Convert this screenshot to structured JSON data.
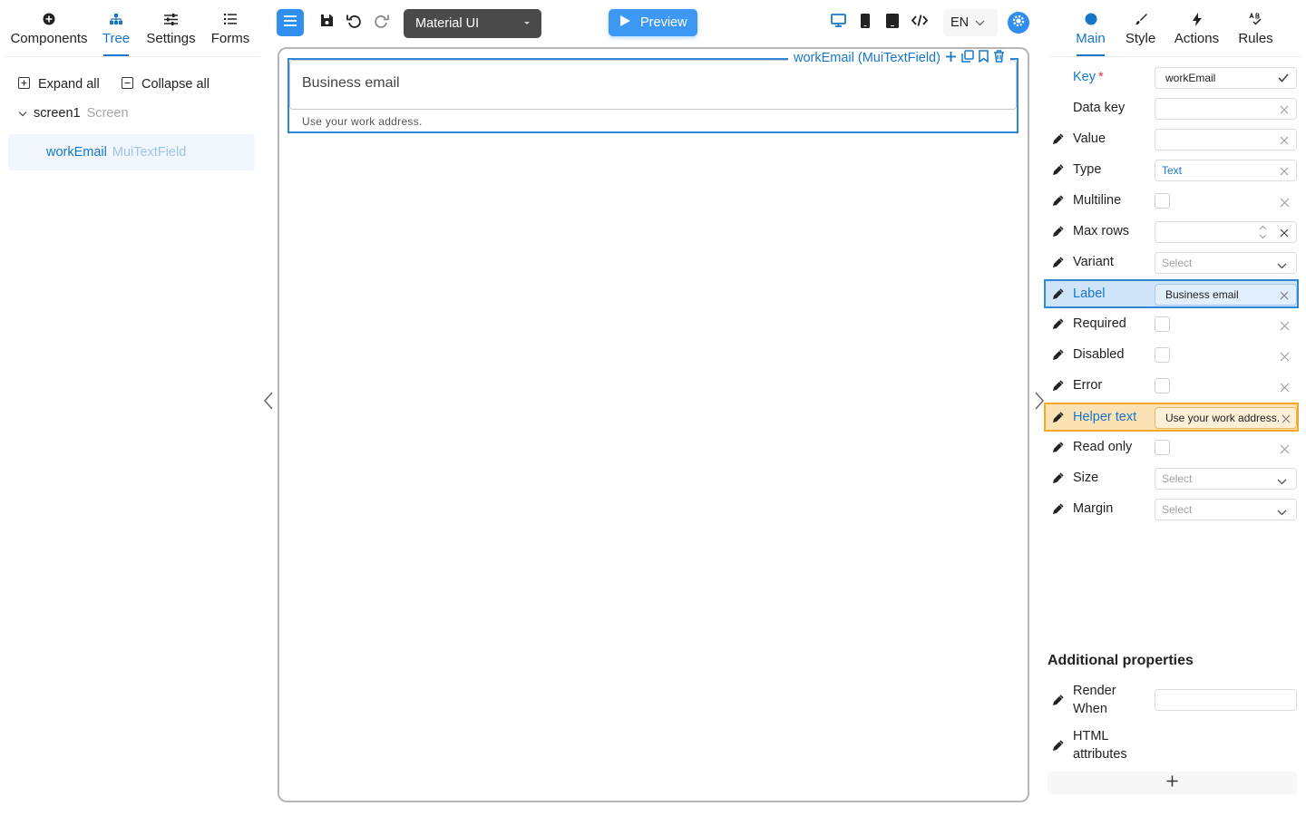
{
  "left_tabs": [
    {
      "label": "Components",
      "icon": "plus-circle-icon"
    },
    {
      "label": "Tree",
      "icon": "hierarchy-icon"
    },
    {
      "label": "Settings",
      "icon": "sliders-icon"
    },
    {
      "label": "Forms",
      "icon": "list-icon"
    }
  ],
  "tree": {
    "expand_all": "Expand all",
    "collapse_all": "Collapse all",
    "root_name": "screen1",
    "root_type": "Screen",
    "node_name": "workEmail",
    "node_type": "MuiTextField"
  },
  "toolbar": {
    "theme": "Material UI",
    "preview": "Preview",
    "language": "EN"
  },
  "canvas": {
    "field_caption": "workEmail (MuiTextField)",
    "field_label": "Business email",
    "field_helper": "Use your work address."
  },
  "right_tabs": [
    {
      "label": "Main",
      "icon": "circle-icon"
    },
    {
      "label": "Style",
      "icon": "brush-icon"
    },
    {
      "label": "Actions",
      "icon": "lightning-icon"
    },
    {
      "label": "Rules",
      "icon": "abc-check-icon"
    }
  ],
  "props": {
    "key_label": "Key",
    "key_value": "workEmail",
    "data_key_label": "Data key",
    "value_label": "Value",
    "type_label": "Type",
    "type_value": "Text",
    "multiline_label": "Multiline",
    "max_rows_label": "Max rows",
    "variant_label": "Variant",
    "select_placeholder": "Select",
    "label_label": "Label",
    "label_value": "Business email",
    "required_label": "Required",
    "disabled_label": "Disabled",
    "error_label": "Error",
    "helper_label": "Helper text",
    "helper_value": "Use your work address.",
    "read_only_label": "Read only",
    "size_label": "Size",
    "margin_label": "Margin"
  },
  "additional": {
    "title": "Additional properties",
    "render_when_line1": "Render",
    "render_when_line2": "When",
    "html_attrs_line1": "HTML",
    "html_attrs_line2": "attributes"
  },
  "colors": {
    "accent": "#1677c8",
    "primary_button": "#2f8ef0",
    "highlight_blue": "#cfe4f8",
    "highlight_orange": "#fbe2b4"
  }
}
